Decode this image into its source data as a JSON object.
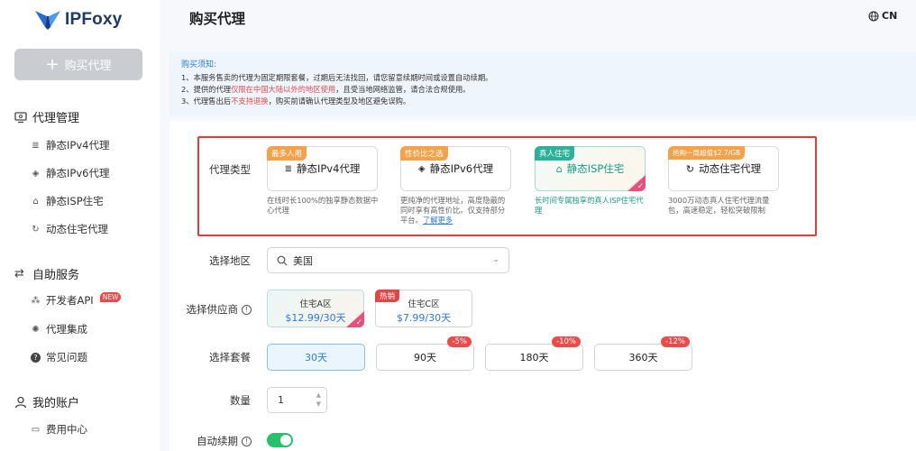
{
  "brand": {
    "name": "IPFoxy"
  },
  "sidebar": {
    "buy_button": "购买代理",
    "sections": [
      {
        "label": "代理管理",
        "icon": "monitor-icon"
      },
      {
        "label": "自助服务",
        "icon": "sync-icon"
      },
      {
        "label": "我的账户",
        "icon": "user-icon"
      }
    ],
    "items": [
      {
        "label": "静态IPv4代理",
        "icon": "server-icon"
      },
      {
        "label": "静态IPv6代理",
        "icon": "layers-icon"
      },
      {
        "label": "静态ISP住宅",
        "icon": "home-icon"
      },
      {
        "label": "动态住宅代理",
        "icon": "refresh-icon"
      },
      {
        "label": "开发者API",
        "icon": "api-icon",
        "badge": "NEW"
      },
      {
        "label": "代理集成",
        "icon": "integration-icon"
      },
      {
        "label": "常见问题",
        "icon": "question-icon"
      },
      {
        "label": "费用中心",
        "icon": "wallet-icon"
      }
    ]
  },
  "header": {
    "title": "购买代理",
    "lang": "CN"
  },
  "notice": {
    "title": "购买须知:",
    "line1": "1、本服务售卖的代理为固定期限套餐，过期后无法找回，请您留意续期时间或设置自动续期。",
    "line2_a": "2、提供的代理",
    "line2_red": "仅限在中国大陆以外的地区使用",
    "line2_b": "，且受当地网络监管，请合法合规使用。",
    "line3_a": "3、代理售出后",
    "line3_red": "不支持退换",
    "line3_b": "，购买前请确认代理类型及地区避免误购。"
  },
  "form": {
    "type_label": "代理类型",
    "region_label": "选择地区",
    "vendor_label": "选择供应商",
    "plan_label": "选择套餐",
    "qty_label": "数量",
    "auto_label": "自动续期"
  },
  "types": [
    {
      "badge": "最多人用",
      "badge_color": "#f3a24a",
      "name": "静态IPv4代理",
      "icon": "server-icon",
      "desc": "在线时长100%的独享静态数据中心代理"
    },
    {
      "badge": "性价比之选",
      "badge_color": "#f3a24a",
      "name": "静态IPv6代理",
      "icon": "layers-icon",
      "desc": "更纯净的代理地址，高度隐蔽的同时享有高性价比。仅支持部分平台。",
      "link": "了解更多"
    },
    {
      "badge": "真人住宅",
      "badge_color": "#2bb09a",
      "name": "静态ISP住宅",
      "icon": "home-icon",
      "desc": "长时间专属独享的真人ISP住宅代理",
      "selected": true
    },
    {
      "badge": "抢购一周超值$2.7/GB",
      "badge_color": "#f3a24a",
      "name": "动态住宅代理",
      "icon": "refresh-icon",
      "desc": "3000万动态真人住宅代理流量包，高速稳定，轻松突破限制"
    }
  ],
  "region": {
    "value": "美国"
  },
  "vendors": [
    {
      "name": "住宅A区",
      "price": "$12.99/30天",
      "selected": true
    },
    {
      "name": "住宅C区",
      "price": "$7.99/30天",
      "badge": "热销"
    }
  ],
  "plans": [
    {
      "label": "30天",
      "selected": true
    },
    {
      "label": "90天",
      "discount": "-5%"
    },
    {
      "label": "180天",
      "discount": "-10%"
    },
    {
      "label": "360天",
      "discount": "-12%"
    }
  ],
  "quantity": {
    "value": "1"
  },
  "auto_renew": {
    "enabled": true
  }
}
